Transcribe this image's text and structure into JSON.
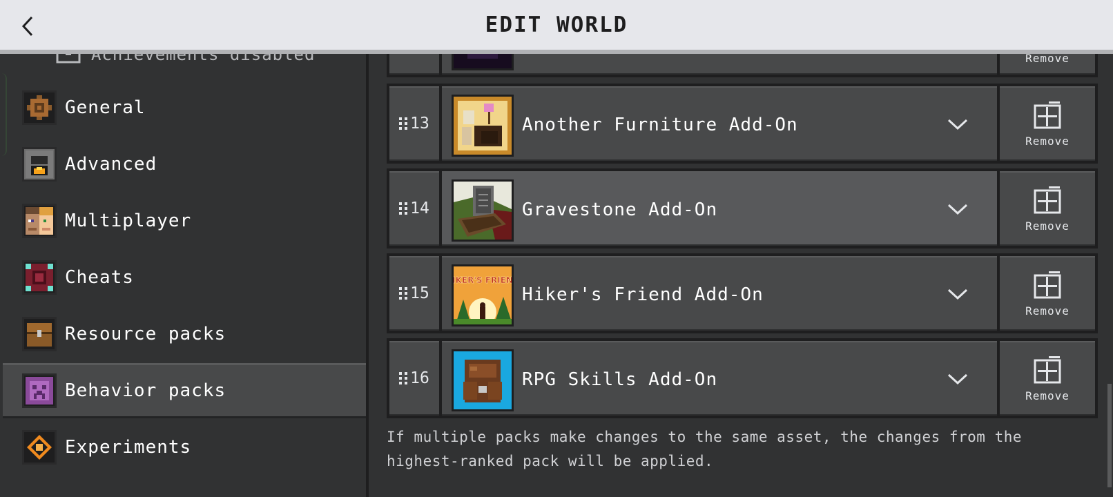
{
  "header": {
    "title": "EDIT WORLD"
  },
  "sidebar": {
    "partial_item": "Achievements disabled",
    "items": [
      {
        "label": "General",
        "icon": "gear-icon"
      },
      {
        "label": "Advanced",
        "icon": "furnace-icon"
      },
      {
        "label": "Multiplayer",
        "icon": "player-face-icon"
      },
      {
        "label": "Cheats",
        "icon": "command-block-icon"
      },
      {
        "label": "Resource packs",
        "icon": "chest-icon"
      },
      {
        "label": "Behavior packs",
        "icon": "creeper-icon",
        "selected": true
      },
      {
        "label": "Experiments",
        "icon": "experiments-icon"
      }
    ]
  },
  "packs": {
    "partial_top": {
      "remove_label": "Remove"
    },
    "rows": [
      {
        "rank": "13",
        "name": "Another Furniture Add-On",
        "remove_label": "Remove"
      },
      {
        "rank": "14",
        "name": "Gravestone Add-On",
        "remove_label": "Remove"
      },
      {
        "rank": "15",
        "name": "Hiker's Friend Add-On",
        "remove_label": "Remove"
      },
      {
        "rank": "16",
        "name": "RPG Skills Add-On",
        "remove_label": "Remove"
      }
    ],
    "thumb_text": {
      "hikers": "HIKER'S FRIEND"
    }
  },
  "note": "If multiple packs make changes to the same asset, the changes from the highest-ranked pack will be applied.",
  "colors": {
    "header_bg": "#e6e7eb",
    "panel_bg": "#313233",
    "row_bg": "#48494a",
    "row_highlight": "#58595b",
    "border_dark": "#1e1e1f"
  }
}
